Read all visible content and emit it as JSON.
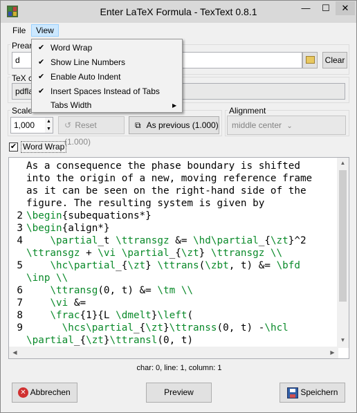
{
  "window": {
    "title": "Enter LaTeX Formula - TexText 0.8.1",
    "minimize_glyph": "—",
    "maximize_glyph": "☐",
    "close_glyph": "✕"
  },
  "menubar": {
    "file": "File",
    "view": "View"
  },
  "view_menu": {
    "items": [
      {
        "label": "Word Wrap",
        "checked": true,
        "check_glyph": "✔"
      },
      {
        "label": "Show Line Numbers",
        "checked": true,
        "check_glyph": "✔"
      },
      {
        "label": "Enable Auto Indent",
        "checked": true,
        "check_glyph": "✔"
      },
      {
        "label": "Insert Spaces Instead of Tabs",
        "checked": true,
        "check_glyph": "✔"
      },
      {
        "label": "Tabs Width",
        "checked": false,
        "check_glyph": "",
        "submenu_glyph": "▶"
      }
    ]
  },
  "preamble": {
    "label": "Prear",
    "value": "d",
    "clear_button": "Clear",
    "folder_icon": "folder-icon"
  },
  "tex_command": {
    "label": "TeX c",
    "value": "pdfla"
  },
  "scale": {
    "label": "Scale",
    "value": "1,000",
    "reset_button": "Reset (1.000)",
    "previous_button": "As previous (1.000)"
  },
  "alignment": {
    "label": "Alignment",
    "value": "middle center"
  },
  "word_wrap_checkbox": {
    "label": "Word Wrap",
    "checked": true,
    "check_glyph": "✔"
  },
  "editor": {
    "lines": [
      {
        "num": "",
        "segments": [
          {
            "t": "As a consequence the phase boundary is shifted",
            "c": "kw"
          }
        ]
      },
      {
        "num": "",
        "segments": [
          {
            "t": "into the origin of a new, moving reference frame",
            "c": "kw"
          }
        ]
      },
      {
        "num": "",
        "segments": [
          {
            "t": "as it can be seen on the right-hand side of the",
            "c": "kw"
          }
        ]
      },
      {
        "num": "",
        "segments": [
          {
            "t": "figure. The resulting system is given by",
            "c": "kw"
          }
        ]
      },
      {
        "num": "2",
        "segments": [
          {
            "t": "\\begin",
            "c": "cmd"
          },
          {
            "t": "{subequations*}",
            "c": "kw"
          }
        ]
      },
      {
        "num": "3",
        "segments": [
          {
            "t": "\\begin",
            "c": "cmd"
          },
          {
            "t": "{align*}",
            "c": "kw"
          }
        ]
      },
      {
        "num": "4",
        "segments": [
          {
            "t": "    ",
            "c": "kw"
          },
          {
            "t": "\\partial",
            "c": "cmd"
          },
          {
            "t": "_t ",
            "c": "kw"
          },
          {
            "t": "\\ttransgz",
            "c": "cmd"
          },
          {
            "t": " &= ",
            "c": "kw"
          },
          {
            "t": "\\hd\\partial",
            "c": "cmd"
          },
          {
            "t": "_{",
            "c": "kw"
          },
          {
            "t": "\\zt",
            "c": "cmd"
          },
          {
            "t": "}^2",
            "c": "kw"
          }
        ]
      },
      {
        "num": "",
        "segments": [
          {
            "t": "\\ttransgz",
            "c": "cmd"
          },
          {
            "t": " + ",
            "c": "kw"
          },
          {
            "t": "\\vi \\partial",
            "c": "cmd"
          },
          {
            "t": "_{",
            "c": "kw"
          },
          {
            "t": "\\zt",
            "c": "cmd"
          },
          {
            "t": "} ",
            "c": "kw"
          },
          {
            "t": "\\ttransgz \\\\",
            "c": "cmd"
          }
        ]
      },
      {
        "num": "5",
        "segments": [
          {
            "t": "    ",
            "c": "kw"
          },
          {
            "t": "\\hc\\partial",
            "c": "cmd"
          },
          {
            "t": "_{",
            "c": "kw"
          },
          {
            "t": "\\zt",
            "c": "cmd"
          },
          {
            "t": "} ",
            "c": "kw"
          },
          {
            "t": "\\ttrans",
            "c": "cmd"
          },
          {
            "t": "(",
            "c": "kw"
          },
          {
            "t": "\\zbt",
            "c": "cmd"
          },
          {
            "t": ", t) &= ",
            "c": "kw"
          },
          {
            "t": "\\bfd",
            "c": "cmd"
          }
        ]
      },
      {
        "num": "",
        "segments": [
          {
            "t": "\\inp \\\\",
            "c": "cmd"
          }
        ]
      },
      {
        "num": "6",
        "segments": [
          {
            "t": "    ",
            "c": "kw"
          },
          {
            "t": "\\ttransg",
            "c": "cmd"
          },
          {
            "t": "(0, t) &= ",
            "c": "kw"
          },
          {
            "t": "\\tm \\\\",
            "c": "cmd"
          }
        ]
      },
      {
        "num": "7",
        "segments": [
          {
            "t": "    ",
            "c": "kw"
          },
          {
            "t": "\\vi",
            "c": "cmd"
          },
          {
            "t": " &=",
            "c": "kw"
          }
        ]
      },
      {
        "num": "8",
        "segments": [
          {
            "t": "    ",
            "c": "kw"
          },
          {
            "t": "\\frac",
            "c": "cmd"
          },
          {
            "t": "{1}{L ",
            "c": "kw"
          },
          {
            "t": "\\dmelt",
            "c": "cmd"
          },
          {
            "t": "}",
            "c": "kw"
          },
          {
            "t": "\\left",
            "c": "cmd"
          },
          {
            "t": "(",
            "c": "kw"
          }
        ]
      },
      {
        "num": "9",
        "segments": [
          {
            "t": "      ",
            "c": "kw"
          },
          {
            "t": "\\hcs\\partial",
            "c": "cmd"
          },
          {
            "t": "_{",
            "c": "kw"
          },
          {
            "t": "\\zt",
            "c": "cmd"
          },
          {
            "t": "}",
            "c": "kw"
          },
          {
            "t": "\\ttranss",
            "c": "cmd"
          },
          {
            "t": "(0, t) -",
            "c": "kw"
          },
          {
            "t": "\\hcl",
            "c": "cmd"
          }
        ]
      },
      {
        "num": "",
        "segments": [
          {
            "t": "\\partial",
            "c": "cmd"
          },
          {
            "t": "_{",
            "c": "kw"
          },
          {
            "t": "\\zt",
            "c": "cmd"
          },
          {
            "t": "}",
            "c": "kw"
          },
          {
            "t": "\\ttransl",
            "c": "cmd"
          },
          {
            "t": "(0, t)",
            "c": "kw"
          }
        ]
      }
    ],
    "first_line_number": "1"
  },
  "status": {
    "text": "char: 0, line: 1, column: 1"
  },
  "buttons": {
    "cancel": "Abbrechen",
    "preview": "Preview",
    "save": "Speichern"
  },
  "colors": {
    "latex_command": "#0a8a2a",
    "menu_highlight": "#cce8ff"
  }
}
